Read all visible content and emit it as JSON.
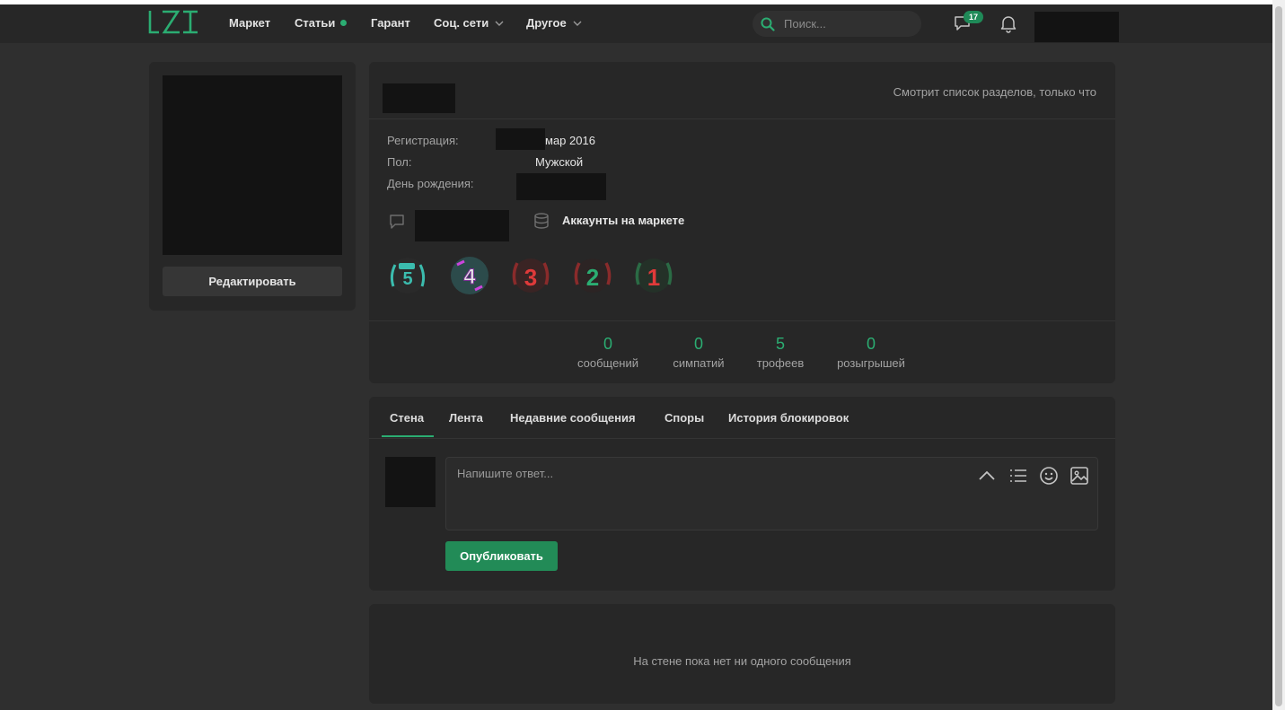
{
  "colors": {
    "accent": "#2bad72",
    "button_primary": "#228b57",
    "background": "#2f2f2f",
    "panel": "#272727"
  },
  "nav": {
    "items": [
      {
        "label": "Маркет"
      },
      {
        "label": "Статьи"
      },
      {
        "label": "Гарант"
      },
      {
        "label": "Соц. сети"
      },
      {
        "label": "Другое"
      }
    ],
    "search_placeholder": "Поиск...",
    "messages_badge": "17",
    "icons": [
      "search-icon",
      "chat-icon",
      "bell-icon",
      "chevron-down-icon"
    ]
  },
  "sidebar": {
    "edit_label": "Редактировать"
  },
  "profile": {
    "status": "Смотрит список разделов, только что",
    "registration_label": "Регистрация:",
    "registration_value": "мар 2016",
    "gender_label": "Пол:",
    "gender_value": "Мужской",
    "birthday_label": "День рождения:",
    "market_link": "Аккаунты на маркете",
    "trophies": [
      {
        "icon": "trophy-5-icon",
        "numeral": "5"
      },
      {
        "icon": "trophy-4-icon",
        "numeral": "4"
      },
      {
        "icon": "trophy-3-icon",
        "numeral": "3"
      },
      {
        "icon": "trophy-2-icon",
        "numeral": "2"
      },
      {
        "icon": "trophy-1-icon",
        "numeral": "1"
      }
    ],
    "stats": [
      {
        "value": "0",
        "label": "сообщений"
      },
      {
        "value": "0",
        "label": "симпатий"
      },
      {
        "value": "5",
        "label": "трофеев"
      },
      {
        "value": "0",
        "label": "розыгрышей"
      }
    ]
  },
  "tabs": [
    {
      "label": "Стена",
      "active": true
    },
    {
      "label": "Лента"
    },
    {
      "label": "Недавние сообщения"
    },
    {
      "label": "Споры"
    },
    {
      "label": "История блокировок"
    }
  ],
  "reply": {
    "placeholder": "Напишите ответ...",
    "publish_label": "Опубликовать",
    "tool_icons": [
      "chevron-up-icon",
      "list-icon",
      "emoji-icon",
      "image-icon"
    ]
  },
  "wall": {
    "empty_text": "На стене пока нет ни одного сообщения"
  }
}
